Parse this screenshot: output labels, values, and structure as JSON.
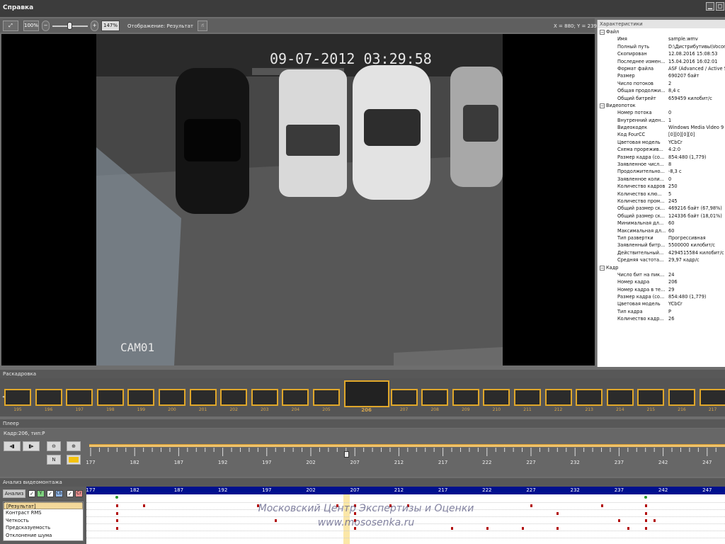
{
  "window": {
    "title": "Справка",
    "min_label": "▁",
    "max_label": "◻"
  },
  "toolbar": {
    "zoom_percent_btn": "100%",
    "zoom_value": "147%",
    "display_label": "Отображение: Результат",
    "coords": "X = 880; Y = 239",
    "zoom_level_fraction": 0.47
  },
  "video": {
    "timestamp": "09-07-2012 03:29:58",
    "camera": "CAM01"
  },
  "properties": {
    "title": "Характеристики",
    "groups": [
      {
        "name": "Файл",
        "rows": [
          [
            "Имя",
            "sample.wmv"
          ],
          [
            "Полный путь",
            "D:\\Дистрибутивы\\Vocor..."
          ],
          [
            "Скопирован",
            "12.08.2016 15:08:53"
          ],
          [
            "Последнее измен...",
            "15.04.2016 16:02:01"
          ],
          [
            "Формат файла",
            "ASF (Advanced / Active S"
          ],
          [
            "Размер",
            "690207 байт"
          ],
          [
            "Число потоков",
            "2"
          ],
          [
            "Общая продолжи...",
            "8,4 с"
          ],
          [
            "Общий битрейт",
            "659459 килобит/с"
          ]
        ]
      },
      {
        "name": "Видеопоток",
        "rows": [
          [
            "Номер потока",
            "0"
          ],
          [
            "Внутренний иден...",
            "1"
          ],
          [
            "Видеокодек",
            "Windows Media Video 9"
          ],
          [
            "Код FourCC",
            "[0][0][0][0]"
          ],
          [
            "Цветовая модель",
            "YCbCr"
          ],
          [
            "Схема прорежив...",
            "4:2:0"
          ],
          [
            "Размер кадра (со...",
            "854:480 (1,779)"
          ],
          [
            "Заявленное числ...",
            "8"
          ],
          [
            "Продолжительно...",
            "-8,3 с"
          ],
          [
            "Заявленное коли...",
            "0"
          ],
          [
            "Количество кадров",
            "250"
          ],
          [
            "Количество клю...",
            "5"
          ],
          [
            "Количество пром...",
            "245"
          ],
          [
            "Общий размер ск...",
            "469216 байт (67,98%)"
          ],
          [
            "Общий размер ск...",
            "124336 байт (18,01%)"
          ],
          [
            "Минимальная дл...",
            "60"
          ],
          [
            "Максимальная дл...",
            "60"
          ],
          [
            "Тип развертки",
            "Прогрессивная"
          ],
          [
            "Заявленный битр...",
            "5500000 килобит/с"
          ],
          [
            "Действительный...",
            "4294515584 килобит/с"
          ],
          [
            "Средняя частота...",
            "29,97 кадр/с"
          ]
        ]
      },
      {
        "name": "Кадр",
        "rows": [
          [
            "Число бит на пик...",
            "24"
          ],
          [
            "Номер кадра",
            "206"
          ],
          [
            "Номер кадра в те...",
            "29"
          ],
          [
            "Размер кадра (со...",
            "854:480 (1,779)"
          ],
          [
            "Цветовая модель",
            "YCbCr"
          ],
          [
            "Тип кадра",
            "P"
          ],
          [
            "Количество кадр...",
            "26"
          ]
        ]
      }
    ]
  },
  "storyboard": {
    "title": "Раскадровка",
    "frames_before": [
      "195",
      "196",
      "197",
      "198",
      "199",
      "200",
      "201",
      "202",
      "203",
      "204",
      "205"
    ],
    "current": "206",
    "frames_after": [
      "207",
      "208",
      "209",
      "210",
      "211",
      "212",
      "213",
      "214",
      "215",
      "216",
      "217"
    ]
  },
  "player": {
    "title": "Плеер",
    "frame_info": "Кадр:206, тип:P",
    "n_label": "N",
    "ticks": [
      "177",
      "182",
      "187",
      "192",
      "197",
      "202",
      "207",
      "212",
      "217",
      "222",
      "227",
      "232",
      "237",
      "242",
      "247"
    ],
    "position_frame": 206
  },
  "analysis": {
    "title": "Анализ видеомонтажа",
    "analyze_label": "Анализ",
    "toggle_labels": [
      "Y",
      "Cb",
      "Cr"
    ],
    "items": [
      "[Результат]",
      "Контраст RMS",
      "Четкость",
      "Предсказуемость",
      "Отклонение шума"
    ],
    "ticks": [
      "177",
      "182",
      "187",
      "192",
      "197",
      "202",
      "207",
      "212",
      "217",
      "222",
      "227",
      "232",
      "237",
      "242",
      "247"
    ]
  },
  "watermark": {
    "line1": "Московский Центр Экспертизы и Оценки",
    "line2": "www.mososenka.ru"
  },
  "colors": {
    "accent": "#e0a72a",
    "scale_bar": "#00108e",
    "marker": "#b31010"
  }
}
